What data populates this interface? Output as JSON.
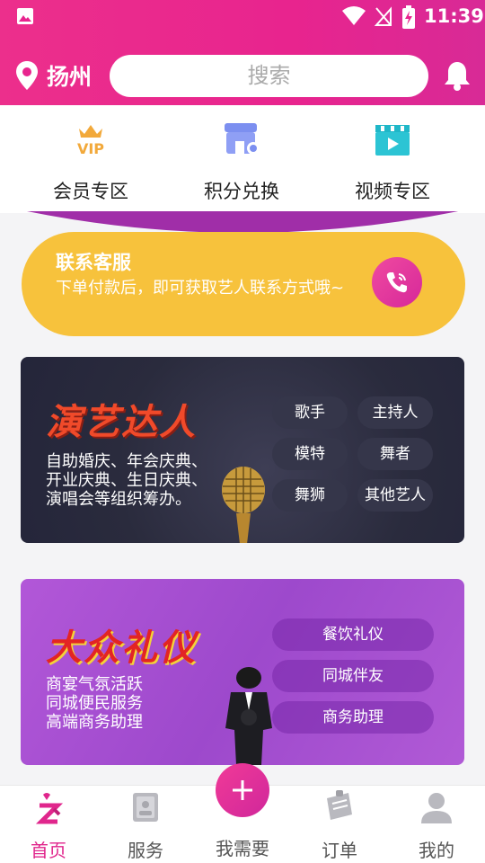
{
  "status_bar": {
    "time": "11:39"
  },
  "header": {
    "city": "扬州",
    "search_placeholder": "搜索"
  },
  "quick_menu": [
    {
      "label": "会员专区",
      "icon": "vip-crown-icon"
    },
    {
      "label": "积分兑换",
      "icon": "points-shop-icon"
    },
    {
      "label": "视频专区",
      "icon": "video-clapper-icon"
    }
  ],
  "contact": {
    "title": "联系客服",
    "description": "下单付款后，即可获取艺人联系方式哦~"
  },
  "banner_performers": {
    "title": "演艺达人",
    "description": "自助婚庆、年会庆典、开业庆典、生日庆典、演唱会等组织筹办。",
    "tags": [
      "歌手",
      "主持人",
      "模特",
      "舞者",
      "舞狮",
      "其他艺人"
    ]
  },
  "banner_etiquette": {
    "title": "大众礼仪",
    "description_lines": [
      "商宴气氛活跃",
      "同城便民服务",
      "高端商务助理"
    ],
    "tags": [
      "餐饮礼仪",
      "同城伴友",
      "商务助理"
    ]
  },
  "bottom_nav": [
    {
      "label": "首页",
      "icon": "home-logo-icon",
      "active": true
    },
    {
      "label": "服务",
      "icon": "service-icon",
      "active": false
    },
    {
      "label": "我需要",
      "icon": "plus-icon",
      "active": false
    },
    {
      "label": "订单",
      "icon": "order-icon",
      "active": false
    },
    {
      "label": "我的",
      "icon": "profile-icon",
      "active": false
    }
  ],
  "colors": {
    "brand": "#e8248e",
    "contact_bg": "#f7c23c",
    "performers_bg": "#2a2b3d",
    "etiquette_bg": "#a64fd0"
  }
}
